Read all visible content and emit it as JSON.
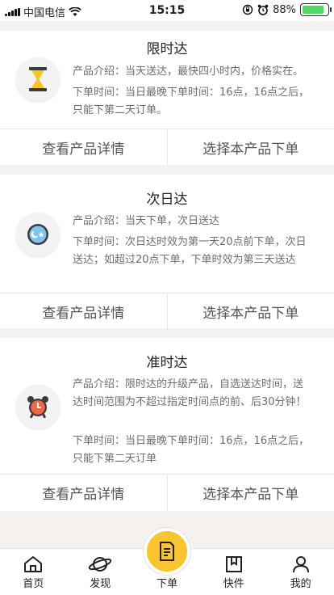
{
  "status_bar": {
    "carrier": "中国电信",
    "time": "15:15",
    "battery": "88%",
    "battery_level": 0.88
  },
  "products": [
    {
      "title": "限时达",
      "icon": "hourglass-icon",
      "intro": "产品介绍：当天送达，最快四小时内，价格实在。",
      "order_time": "下单时间：当日最晚下单时间：16点，16点之后，只能下第二天订单。",
      "detail_label": "查看产品详情",
      "select_label": "选择本产品下单"
    },
    {
      "title": "次日达",
      "icon": "day-night-icon",
      "intro": "产品介绍：当天下单，次日送达",
      "order_time": "下单时间：次日达时效为第一天20点前下单，次日送达；如超过20点下单，下单时效为第三天送达",
      "detail_label": "查看产品详情",
      "select_label": "选择本产品下单"
    },
    {
      "title": "准时达",
      "icon": "alarm-clock-icon",
      "intro": "产品介绍：限时达的升级产品，自选送达时间，送达时间范围为不超过指定时间点的前、后30分钟！",
      "order_time": "下单时间：当日最晚下单时间：16点，16点之后，只能下第二天订单",
      "detail_label": "查看产品详情",
      "select_label": "选择本产品下单"
    }
  ],
  "tabbar": {
    "home": "首页",
    "discover": "发现",
    "order": "下单",
    "express": "快件",
    "mine": "我的"
  },
  "colors": {
    "accent": "#f8c530",
    "text_gray": "#6e6e6e"
  }
}
